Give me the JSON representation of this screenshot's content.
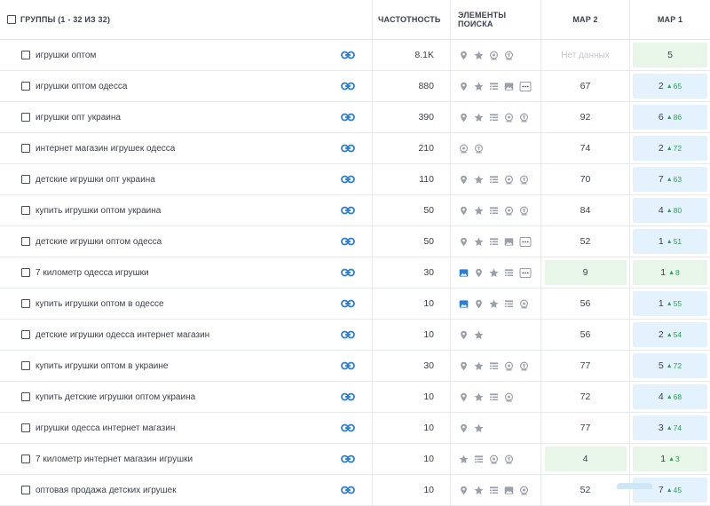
{
  "header": {
    "groups_label": "ГРУППЫ (1 - 32 ИЗ 32)",
    "freq_label": "ЧАСТОТНОСТЬ",
    "features_label": "ЭЛЕМЕНТЫ ПОИСКА",
    "map2_label": "MAP 2",
    "map1_label": "MAP 1"
  },
  "colors": {
    "link_blue": "#2a7fd4",
    "feature_gray": "#9aa0aa",
    "image_blue": "#2a7fd4",
    "green_bg": "#e8f6ea",
    "blue_bg": "#e3f2fc",
    "delta_green": "#2e9e55"
  },
  "rows": [
    {
      "keyword": "игрушки оптом",
      "freq": "8.1K",
      "features": [
        "pin",
        "star",
        "coin",
        "coin2"
      ],
      "map2": "Нет данных",
      "map2_style": "nodata",
      "map1": "5",
      "map1_delta": "",
      "map1_style": "green"
    },
    {
      "keyword": "игрушки оптом одесса",
      "freq": "880",
      "features": [
        "pin",
        "star",
        "list",
        "image",
        "more"
      ],
      "map2": "67",
      "map2_style": "plain",
      "map1": "2",
      "map1_delta": "65",
      "map1_style": "blue"
    },
    {
      "keyword": "игрушки опт украина",
      "freq": "390",
      "features": [
        "pin",
        "star",
        "list",
        "coin",
        "coin2"
      ],
      "map2": "92",
      "map2_style": "plain",
      "map1": "6",
      "map1_delta": "86",
      "map1_style": "blue"
    },
    {
      "keyword": "интернет магазин игрушек одесса",
      "freq": "210",
      "features": [
        "coin",
        "coin2"
      ],
      "map2": "74",
      "map2_style": "plain",
      "map1": "2",
      "map1_delta": "72",
      "map1_style": "blue"
    },
    {
      "keyword": "детские игрушки опт украина",
      "freq": "110",
      "features": [
        "pin",
        "star",
        "list",
        "coin",
        "coin2"
      ],
      "map2": "70",
      "map2_style": "plain",
      "map1": "7",
      "map1_delta": "63",
      "map1_style": "blue"
    },
    {
      "keyword": "купить игрушки оптом украина",
      "freq": "50",
      "features": [
        "pin",
        "star",
        "list",
        "coin",
        "coin2"
      ],
      "map2": "84",
      "map2_style": "plain",
      "map1": "4",
      "map1_delta": "80",
      "map1_style": "blue"
    },
    {
      "keyword": "детские игрушки оптом одесса",
      "freq": "50",
      "features": [
        "pin",
        "star",
        "list",
        "image",
        "more"
      ],
      "map2": "52",
      "map2_style": "plain",
      "map1": "1",
      "map1_delta": "51",
      "map1_style": "blue"
    },
    {
      "keyword": "7 километр одесса игрушки",
      "freq": "30",
      "features": [
        "image_blue",
        "pin",
        "star",
        "list",
        "more"
      ],
      "map2": "9",
      "map2_style": "green",
      "map1": "1",
      "map1_delta": "8",
      "map1_style": "green"
    },
    {
      "keyword": "купить игрушки оптом в одессе",
      "freq": "10",
      "features": [
        "image_blue",
        "pin",
        "star",
        "list",
        "coin"
      ],
      "map2": "56",
      "map2_style": "plain",
      "map1": "1",
      "map1_delta": "55",
      "map1_style": "blue"
    },
    {
      "keyword": "детские игрушки одесса интернет магазин",
      "freq": "10",
      "features": [
        "pin",
        "star"
      ],
      "map2": "56",
      "map2_style": "plain",
      "map1": "2",
      "map1_delta": "54",
      "map1_style": "blue"
    },
    {
      "keyword": "купить игрушки оптом в украине",
      "freq": "30",
      "features": [
        "pin",
        "star",
        "list",
        "coin",
        "coin2"
      ],
      "map2": "77",
      "map2_style": "plain",
      "map1": "5",
      "map1_delta": "72",
      "map1_style": "blue"
    },
    {
      "keyword": "купить детские игрушки оптом украина",
      "freq": "10",
      "features": [
        "pin",
        "star",
        "list",
        "coin"
      ],
      "map2": "72",
      "map2_style": "plain",
      "map1": "4",
      "map1_delta": "68",
      "map1_style": "blue"
    },
    {
      "keyword": "игрушки одесса интернет магазин",
      "freq": "10",
      "features": [
        "pin",
        "star"
      ],
      "map2": "77",
      "map2_style": "plain",
      "map1": "3",
      "map1_delta": "74",
      "map1_style": "blue"
    },
    {
      "keyword": "7 километр интернет магазин игрушки",
      "freq": "10",
      "features": [
        "star",
        "list",
        "coin",
        "coin2"
      ],
      "map2": "4",
      "map2_style": "green",
      "map1": "1",
      "map1_delta": "3",
      "map1_style": "green"
    },
    {
      "keyword": "оптовая продажа детских игрушек",
      "freq": "10",
      "features": [
        "pin",
        "star",
        "list",
        "image",
        "coin"
      ],
      "map2": "52",
      "map2_style": "plain",
      "map1": "7",
      "map1_delta": "45",
      "map1_style": "blue"
    }
  ]
}
